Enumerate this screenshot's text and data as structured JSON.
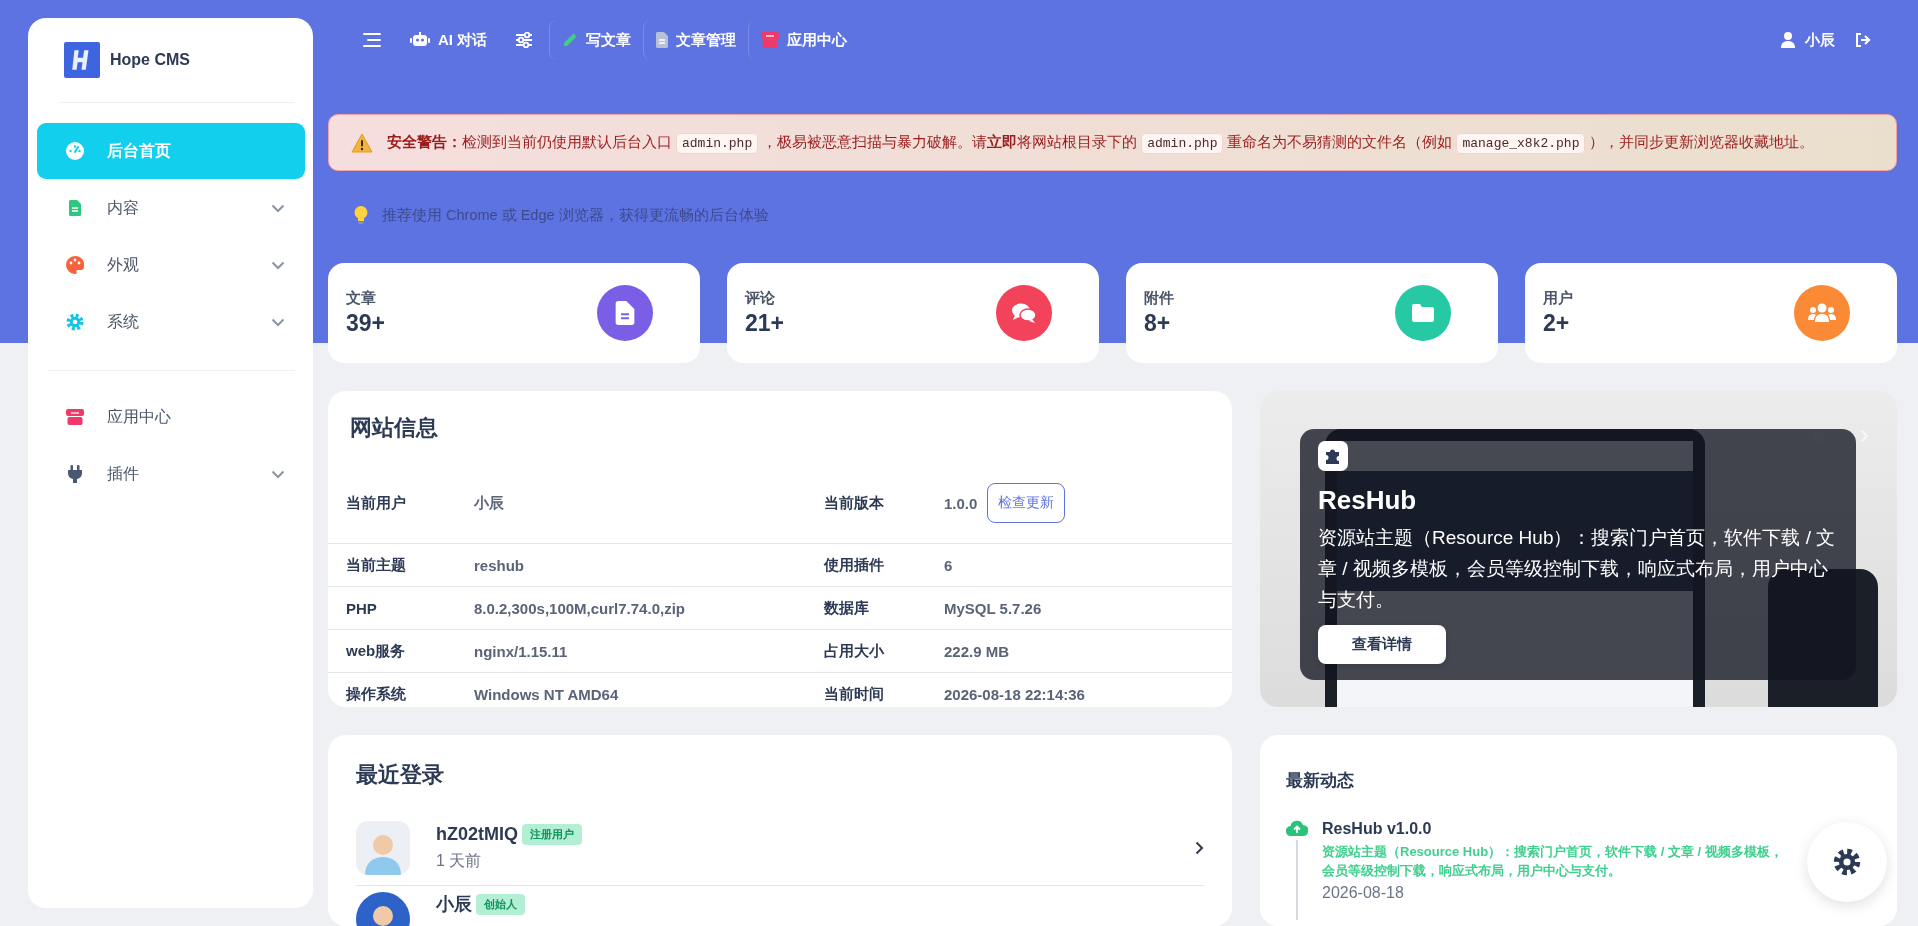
{
  "sidebar": {
    "logo_text": "Hope CMS",
    "sections": [
      {
        "items": [
          {
            "kind": "link",
            "label": "后台首页",
            "selected": true
          },
          {
            "kind": "group",
            "label": "内容",
            "selected": false,
            "expanded": false
          },
          {
            "kind": "group",
            "label": "外观",
            "selected": false,
            "expanded": false
          },
          {
            "kind": "group",
            "label": "系统",
            "selected": false,
            "expanded": false
          }
        ]
      },
      {
        "items": [
          {
            "kind": "link",
            "label": "应用中心",
            "selected": false
          },
          {
            "kind": "group",
            "label": "插件",
            "selected": false,
            "expanded": false
          }
        ]
      }
    ]
  },
  "topbar": {
    "nav": [
      {
        "label": "AI 对话"
      },
      {
        "label": "写文章"
      },
      {
        "label": "文章管理"
      },
      {
        "label": "应用中心"
      }
    ],
    "user": "小辰"
  },
  "alert": {
    "parts": [
      {
        "kind": "text",
        "text": "**安全警告：**检测到当前仍使用默认后台入口"
      },
      {
        "kind": "code",
        "text": "admin.php"
      },
      {
        "kind": "text",
        "text": "，极易被恶意扫描与暴力破解。请**立即**将网站根目录下的"
      },
      {
        "kind": "code",
        "text": "admin.php"
      },
      {
        "kind": "text",
        "text": "重命名为不易猜测的文件名（例如"
      },
      {
        "kind": "code",
        "text": "manage_x8k2.php"
      },
      {
        "kind": "text",
        "text": "），并同步更新浏览器收藏地址。"
      }
    ]
  },
  "tip": "推荐使用 Chrome 或 Edge 浏览器，获得更流畅的后台体验",
  "stats": [
    {
      "label": "文章",
      "value": "39+",
      "color": "#7a5fe6"
    },
    {
      "label": "评论",
      "value": "21+",
      "color": "#f2435a"
    },
    {
      "label": "附件",
      "value": "8+",
      "color": "#26c9a4"
    },
    {
      "label": "用户",
      "value": "2+",
      "color": "#fb8a36"
    }
  ],
  "site_info": {
    "title": "网站信息",
    "check_update_button": "检查更新",
    "rows": [
      {
        "left": {
          "label": "当前用户",
          "value": "小辰"
        },
        "right": {
          "label": "当前版本",
          "value": "1.0.0"
        }
      },
      {
        "left": {
          "label": "当前主题",
          "value": "reshub"
        },
        "right": {
          "label": "使用插件",
          "value": "6"
        }
      },
      {
        "left": {
          "label": "PHP",
          "value": "8.0.2,300s,100M,curl7.74.0,zip"
        },
        "right": {
          "label": "数据库",
          "value": "MySQL 5.7.26"
        }
      },
      {
        "left": {
          "label": "web服务",
          "value": "nginx/1.15.11"
        },
        "right": {
          "label": "占用大小",
          "value": "222.9 MB"
        }
      },
      {
        "left": {
          "label": "操作系统",
          "value": "Windows NT AMD64"
        },
        "right": {
          "label": "当前时间",
          "value": "2026-08-18 22:14:36"
        }
      }
    ]
  },
  "banner": {
    "title": "ResHub",
    "description": "资源站主题（Resource Hub）：搜索门户首页，软件下载 / 文章 / 视频多模板，会员等级控制下载，响应式布局，用户中心与支付。",
    "button": "查看详情"
  },
  "recent_logins": {
    "title": "最近登录",
    "users": [
      {
        "name": "hZ02tMIQ",
        "role": "注册用户",
        "time": "1 天前"
      },
      {
        "name": "小辰",
        "role": "创始人"
      }
    ]
  },
  "activity": {
    "title": "最新动态",
    "items": [
      {
        "title": "ResHub v1.0.0",
        "description": "资源站主题（Resource Hub）：搜索门户首页，软件下载 / 文章 / 视频多模板，会员等级控制下载，响应式布局，用户中心与支付。",
        "date": "2026-08-18"
      }
    ]
  }
}
